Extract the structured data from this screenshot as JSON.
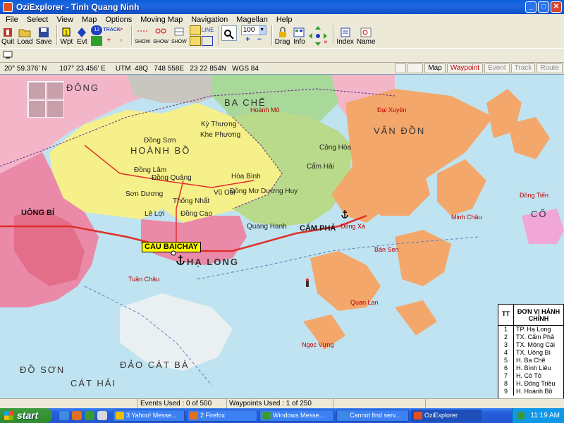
{
  "window": {
    "title": "OziExplorer - Tinh Quang Ninh"
  },
  "menu": [
    "File",
    "Select",
    "View",
    "Map",
    "Options",
    "Moving Map",
    "Navigation",
    "Magellan",
    "Help"
  ],
  "toolbar": {
    "quit": "Quit",
    "load": "Load",
    "save": "Save",
    "wpt": "Wpt",
    "evt": "Evt",
    "track": "TRACK",
    "show1": "SHOW",
    "show2": "SHOW",
    "show3": "SHOW",
    "zoom_value": "100",
    "drag": "Drag",
    "info": "Info",
    "index": "Index",
    "name": "Name"
  },
  "coords": {
    "lat": "20° 59.376' N",
    "lon": "107° 23.456' E",
    "utm": "UTM  48Q   748 558E   23 22 854N",
    "datum": "WGS 84"
  },
  "modes": [
    {
      "label": "Map",
      "state": "normal"
    },
    {
      "label": "Waypoint",
      "state": "active"
    },
    {
      "label": "Event",
      "state": "dim"
    },
    {
      "label": "Track",
      "state": "dim"
    },
    {
      "label": "Route",
      "state": "dim"
    }
  ],
  "map": {
    "waypoint_label": "CAU BAICHAY",
    "regions": [
      "HOÀNH BỒ",
      "VÂN ĐỒN",
      "HẠ LONG",
      "CẨM PHẢ",
      "BA CHẼ",
      "ĐẢO CÁT BÀ",
      "CÁT HẢI",
      "ĐỒ SƠN",
      "ĐÔNG",
      "UÔNG BÍ",
      "CỐ"
    ],
    "places": [
      "Đồng Sơn",
      "Kỳ Thượng",
      "Khe Phương",
      "Đồng Lâm",
      "Đồng Quảng",
      "Sơn Dương",
      "Thống Nhất",
      "Đồng Cao",
      "Lê Lợi",
      "Hòa Bình",
      "Vũ Oai",
      "Đồng Mơ",
      "Dương Huy",
      "Quang Hanh",
      "Cộng Hòa",
      "Cẩm Hải",
      "Đại Xuyên",
      "Minh Châu",
      "Quan Lạn",
      "Ngọc Vừng",
      "Bản Sen",
      "Đông Xá",
      "Tuần Châu",
      "Hoành Mô",
      "Đồng Tiến"
    ],
    "legend": {
      "col1": "TT",
      "col2": "ĐƠN VỊ HÀNH CHÍNH",
      "rows": [
        {
          "n": "1",
          "name": "TP. Hạ Long"
        },
        {
          "n": "2",
          "name": "TX. Cẩm Phả"
        },
        {
          "n": "3",
          "name": "TX. Móng Cái"
        },
        {
          "n": "4",
          "name": "TX. Uông Bí"
        },
        {
          "n": "5",
          "name": "H. Ba Chẽ"
        },
        {
          "n": "6",
          "name": "H. Bình Liêu"
        },
        {
          "n": "7",
          "name": "H. Cô Tô"
        },
        {
          "n": "8",
          "name": "H. Đông Triều"
        },
        {
          "n": "9",
          "name": "H. Hoành Bồ"
        }
      ]
    }
  },
  "status": {
    "events": "Events Used : 0 of 500",
    "waypoints": "Waypoints Used : 1 of 250"
  },
  "taskbar": {
    "start": "start",
    "tasks": [
      {
        "label": "3 Yahoo! Messe...",
        "active": false
      },
      {
        "label": "2 Firefox",
        "active": false
      },
      {
        "label": "Windows Messe...",
        "active": false
      },
      {
        "label": "Cannot find serv...",
        "active": false
      },
      {
        "label": "OziExplorer",
        "active": true
      }
    ],
    "clock": "11:19 AM"
  }
}
